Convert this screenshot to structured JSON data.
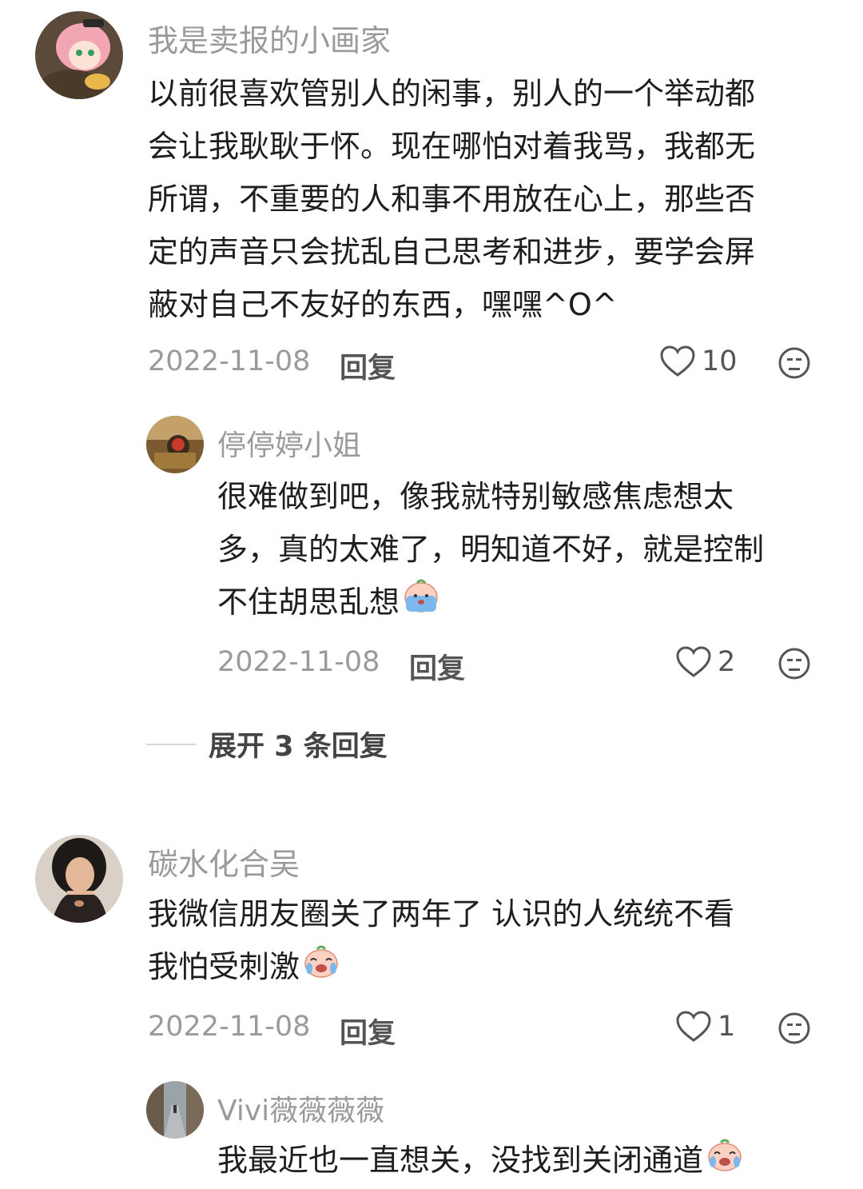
{
  "comments": [
    {
      "username": "我是卖报的小画家",
      "lines": [
        "以前很喜欢管别人的闲事，别人的一个举动都",
        "会让我耿耿于怀。现在哪怕对着我骂，我都无",
        "所谓，不重要的人和事不用放在心上，那些否",
        "定的声音只会扰乱自己思考和进步，要学会屏",
        "蔽对自己不友好的东西，嘿嘿^O^"
      ],
      "date": "2022-11-08",
      "reply_label": "回复",
      "likes": "10",
      "replies": [
        {
          "username": "停停婷小姐",
          "lines": [
            "很难做到吧，像我就特别敏感焦虑想太",
            "多，真的太难了，明知道不好，就是控制",
            "不住胡思乱想"
          ],
          "date": "2022-11-08",
          "reply_label": "回复",
          "likes": "2"
        }
      ],
      "expand_label": "展开 3 条回复"
    },
    {
      "username": "碳水化合吴",
      "lines": [
        "我微信朋友圈关了两年了 认识的人统统不看",
        "我怕受刺激"
      ],
      "date": "2022-11-08",
      "reply_label": "回复",
      "likes": "1",
      "replies": [
        {
          "username": "Vivi薇薇薇薇",
          "lines": [
            "我最近也一直想关，没找到关闭通道"
          ]
        }
      ]
    }
  ],
  "icons": {
    "like": "heart-outline-icon",
    "dislike": "meh-face-icon",
    "emoji_cry": "crying-face-emoji"
  },
  "colors": {
    "username": "#9a9a9a",
    "text": "#1e1e1e",
    "meta": "#9a9a9a"
  }
}
